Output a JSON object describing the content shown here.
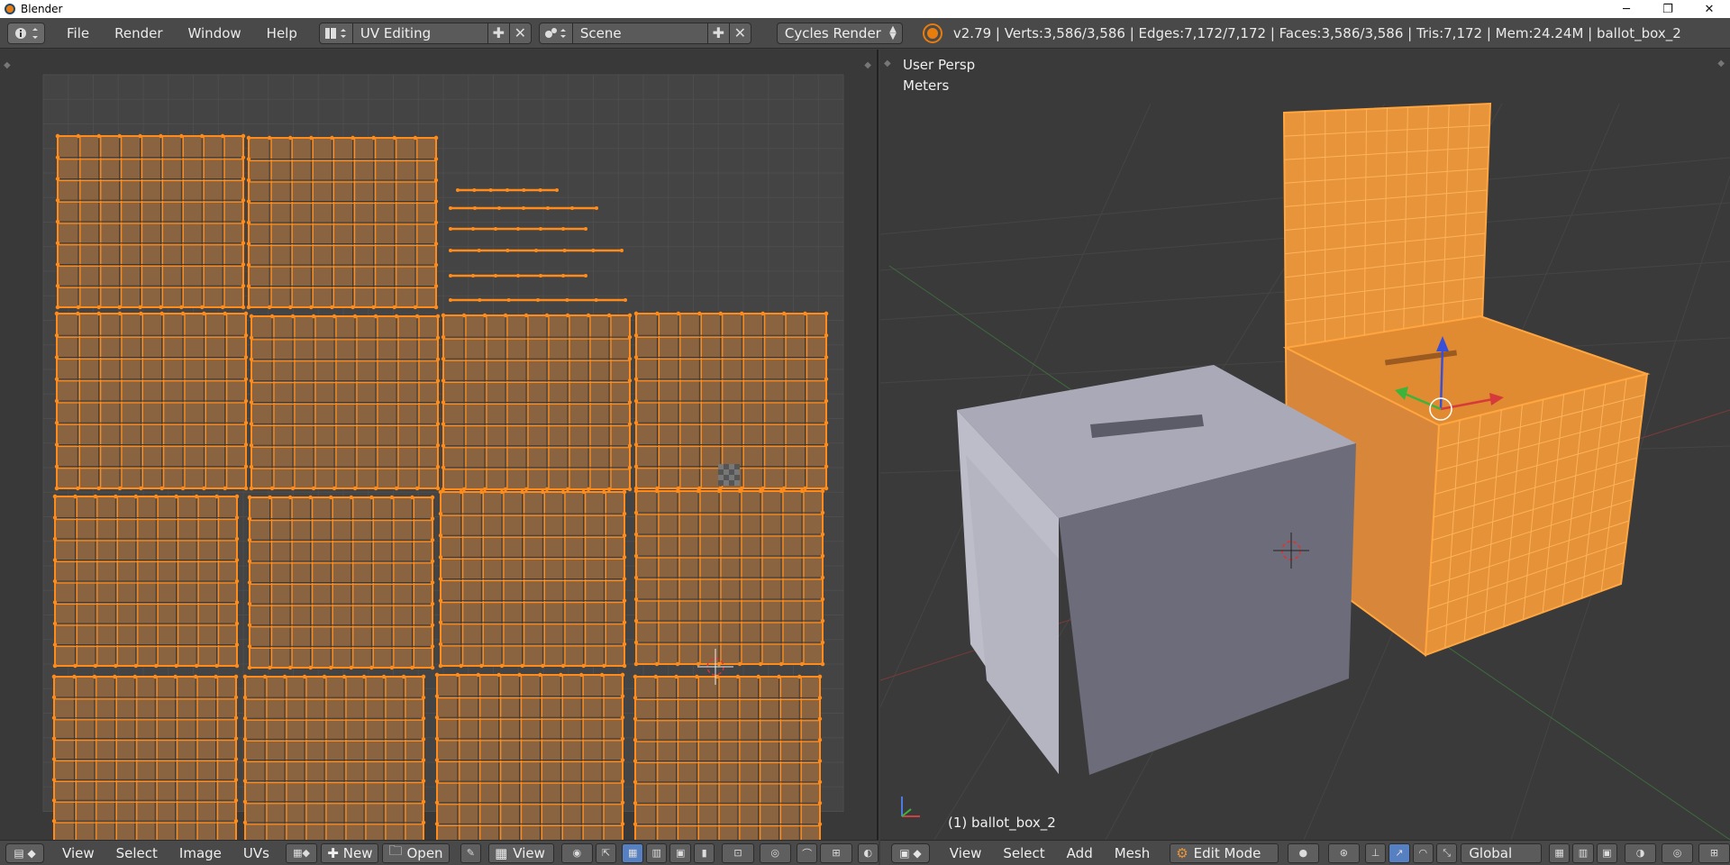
{
  "window": {
    "title": "Blender",
    "controls": [
      "─",
      "❐",
      "✕"
    ]
  },
  "top_header": {
    "menus": [
      "File",
      "Render",
      "Window",
      "Help"
    ],
    "screen_layout": "UV Editing",
    "scene": "Scene",
    "render_engine": "Cycles Render",
    "stats": "v2.79 | Verts:3,586/3,586 | Edges:7,172/7,172 | Faces:3,586/3,586 | Tris:7,172 | Mem:24.24M | ballot_box_2"
  },
  "uv_editor": {
    "bottom_menus": [
      "View",
      "Select",
      "Image",
      "UVs"
    ],
    "new_label": "New",
    "open_label": "Open",
    "view_label": "View"
  },
  "view3d": {
    "view_name": "User Persp",
    "units": "Meters",
    "object_label": "(1) ballot_box_2",
    "bottom_menus": [
      "View",
      "Select",
      "Add",
      "Mesh"
    ],
    "mode": "Edit Mode",
    "transform_orientation": "Global"
  },
  "colors": {
    "uv_fill": "#8a6340",
    "uv_edge": "#ff8c1a",
    "mesh_fill": "#e8943a",
    "box_top": "#a9a9b8",
    "box_front": "#6c6c7a",
    "box_side": "#bdbdc9",
    "active_button": "#5680c2"
  }
}
